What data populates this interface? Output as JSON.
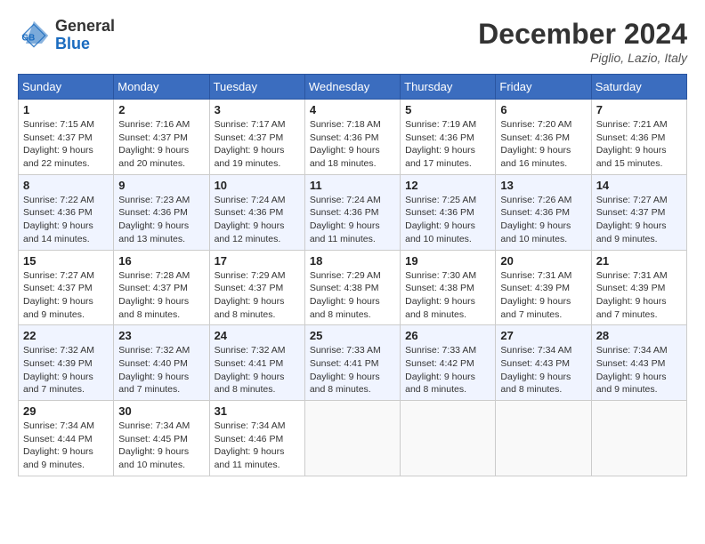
{
  "header": {
    "logo": {
      "general": "General",
      "blue": "Blue"
    },
    "title": "December 2024",
    "location": "Piglio, Lazio, Italy"
  },
  "weekdays": [
    "Sunday",
    "Monday",
    "Tuesday",
    "Wednesday",
    "Thursday",
    "Friday",
    "Saturday"
  ],
  "weeks": [
    [
      {
        "day": 1,
        "sunrise": "7:15 AM",
        "sunset": "4:37 PM",
        "daylight": "9 hours and 22 minutes."
      },
      {
        "day": 2,
        "sunrise": "7:16 AM",
        "sunset": "4:37 PM",
        "daylight": "9 hours and 20 minutes."
      },
      {
        "day": 3,
        "sunrise": "7:17 AM",
        "sunset": "4:37 PM",
        "daylight": "9 hours and 19 minutes."
      },
      {
        "day": 4,
        "sunrise": "7:18 AM",
        "sunset": "4:36 PM",
        "daylight": "9 hours and 18 minutes."
      },
      {
        "day": 5,
        "sunrise": "7:19 AM",
        "sunset": "4:36 PM",
        "daylight": "9 hours and 17 minutes."
      },
      {
        "day": 6,
        "sunrise": "7:20 AM",
        "sunset": "4:36 PM",
        "daylight": "9 hours and 16 minutes."
      },
      {
        "day": 7,
        "sunrise": "7:21 AM",
        "sunset": "4:36 PM",
        "daylight": "9 hours and 15 minutes."
      }
    ],
    [
      {
        "day": 8,
        "sunrise": "7:22 AM",
        "sunset": "4:36 PM",
        "daylight": "9 hours and 14 minutes."
      },
      {
        "day": 9,
        "sunrise": "7:23 AM",
        "sunset": "4:36 PM",
        "daylight": "9 hours and 13 minutes."
      },
      {
        "day": 10,
        "sunrise": "7:24 AM",
        "sunset": "4:36 PM",
        "daylight": "9 hours and 12 minutes."
      },
      {
        "day": 11,
        "sunrise": "7:24 AM",
        "sunset": "4:36 PM",
        "daylight": "9 hours and 11 minutes."
      },
      {
        "day": 12,
        "sunrise": "7:25 AM",
        "sunset": "4:36 PM",
        "daylight": "9 hours and 10 minutes."
      },
      {
        "day": 13,
        "sunrise": "7:26 AM",
        "sunset": "4:36 PM",
        "daylight": "9 hours and 10 minutes."
      },
      {
        "day": 14,
        "sunrise": "7:27 AM",
        "sunset": "4:37 PM",
        "daylight": "9 hours and 9 minutes."
      }
    ],
    [
      {
        "day": 15,
        "sunrise": "7:27 AM",
        "sunset": "4:37 PM",
        "daylight": "9 hours and 9 minutes."
      },
      {
        "day": 16,
        "sunrise": "7:28 AM",
        "sunset": "4:37 PM",
        "daylight": "9 hours and 8 minutes."
      },
      {
        "day": 17,
        "sunrise": "7:29 AM",
        "sunset": "4:37 PM",
        "daylight": "9 hours and 8 minutes."
      },
      {
        "day": 18,
        "sunrise": "7:29 AM",
        "sunset": "4:38 PM",
        "daylight": "9 hours and 8 minutes."
      },
      {
        "day": 19,
        "sunrise": "7:30 AM",
        "sunset": "4:38 PM",
        "daylight": "9 hours and 8 minutes."
      },
      {
        "day": 20,
        "sunrise": "7:31 AM",
        "sunset": "4:39 PM",
        "daylight": "9 hours and 7 minutes."
      },
      {
        "day": 21,
        "sunrise": "7:31 AM",
        "sunset": "4:39 PM",
        "daylight": "9 hours and 7 minutes."
      }
    ],
    [
      {
        "day": 22,
        "sunrise": "7:32 AM",
        "sunset": "4:39 PM",
        "daylight": "9 hours and 7 minutes."
      },
      {
        "day": 23,
        "sunrise": "7:32 AM",
        "sunset": "4:40 PM",
        "daylight": "9 hours and 7 minutes."
      },
      {
        "day": 24,
        "sunrise": "7:32 AM",
        "sunset": "4:41 PM",
        "daylight": "9 hours and 8 minutes."
      },
      {
        "day": 25,
        "sunrise": "7:33 AM",
        "sunset": "4:41 PM",
        "daylight": "9 hours and 8 minutes."
      },
      {
        "day": 26,
        "sunrise": "7:33 AM",
        "sunset": "4:42 PM",
        "daylight": "9 hours and 8 minutes."
      },
      {
        "day": 27,
        "sunrise": "7:34 AM",
        "sunset": "4:43 PM",
        "daylight": "9 hours and 8 minutes."
      },
      {
        "day": 28,
        "sunrise": "7:34 AM",
        "sunset": "4:43 PM",
        "daylight": "9 hours and 9 minutes."
      }
    ],
    [
      {
        "day": 29,
        "sunrise": "7:34 AM",
        "sunset": "4:44 PM",
        "daylight": "9 hours and 9 minutes."
      },
      {
        "day": 30,
        "sunrise": "7:34 AM",
        "sunset": "4:45 PM",
        "daylight": "9 hours and 10 minutes."
      },
      {
        "day": 31,
        "sunrise": "7:34 AM",
        "sunset": "4:46 PM",
        "daylight": "9 hours and 11 minutes."
      },
      null,
      null,
      null,
      null
    ]
  ]
}
